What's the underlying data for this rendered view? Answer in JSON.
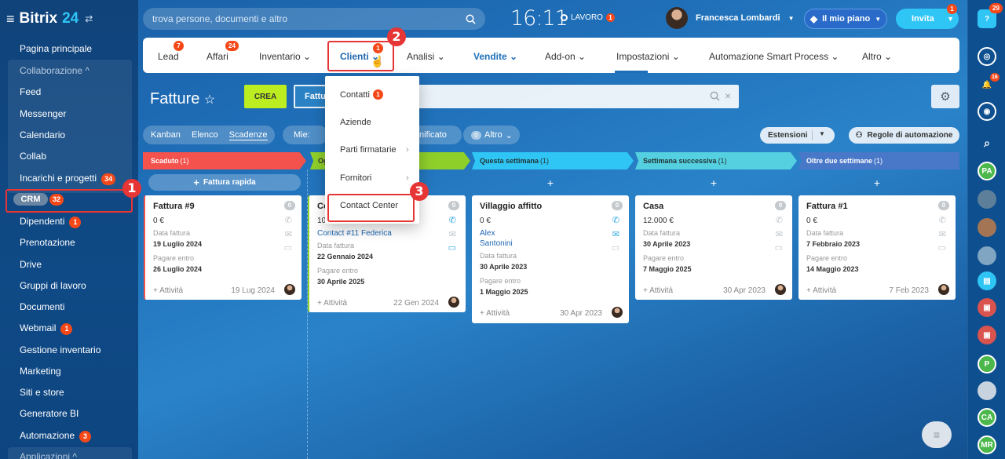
{
  "app": {
    "logo_text": "Bitrix",
    "logo_num": "24",
    "search_placeholder": "trova persone, documenti e altro",
    "clock": "16:11",
    "work_label": "LAVORO",
    "work_badge": "1",
    "user_name": "Francesca Lombardi",
    "plan_label": "Il mio piano",
    "invite_label": "Invita",
    "invite_badge": "1"
  },
  "sidebar": {
    "items": [
      {
        "label": "Pagina principale"
      },
      {
        "label": "Collaborazione ^"
      },
      {
        "label": "Feed"
      },
      {
        "label": "Messenger"
      },
      {
        "label": "Calendario"
      },
      {
        "label": "Collab"
      },
      {
        "label": "Incarichi e progetti",
        "badge": "34"
      },
      {
        "label": "CRM",
        "badge": "32"
      },
      {
        "label": "Dipendenti",
        "badge": "1"
      },
      {
        "label": "Prenotazione"
      },
      {
        "label": "Drive"
      },
      {
        "label": "Gruppi di lavoro"
      },
      {
        "label": "Documenti"
      },
      {
        "label": "Webmail",
        "badge": "1"
      },
      {
        "label": "Gestione inventario"
      },
      {
        "label": "Marketing"
      },
      {
        "label": "Siti e store"
      },
      {
        "label": "Generatore BI"
      },
      {
        "label": "Automazione",
        "badge": "3"
      },
      {
        "label": "Applicazioni ^"
      }
    ]
  },
  "crm_nav": {
    "tabs": [
      {
        "label": "Lead",
        "badge": "7"
      },
      {
        "label": "Affari",
        "badge": "24"
      },
      {
        "label": "Inventario"
      },
      {
        "label": "Clienti",
        "badge": "1"
      },
      {
        "label": "Analisi"
      },
      {
        "label": "Vendite"
      },
      {
        "label": "Add-on"
      },
      {
        "label": "Impostazioni"
      },
      {
        "label": "Automazione Smart Process"
      },
      {
        "label": "Altro"
      }
    ]
  },
  "page": {
    "title": "Fatture",
    "create_label": "CREA",
    "filter_chip": "Fattu",
    "views": [
      "Kanban",
      "Elenco",
      "Scadenze"
    ],
    "my_label": "Mie:",
    "pianificato": "nificato",
    "altro": "Altro",
    "altro_count": "0",
    "estensioni": "Estensioni",
    "regole": "Regole di automazione"
  },
  "dropdown": {
    "items": [
      {
        "label": "Contatti",
        "badge": "1"
      },
      {
        "label": "Aziende"
      },
      {
        "label": "Parti firmatarie"
      },
      {
        "label": "Fornitori"
      },
      {
        "label": "Contact Center"
      }
    ]
  },
  "steps": [
    "1",
    "2",
    "3"
  ],
  "columns": [
    {
      "title": "Scaduto",
      "count": "(1)",
      "color": "#f4524d",
      "add_label": "Fattura rapida"
    },
    {
      "title": "Og",
      "count": "",
      "color": "#8fcf2a",
      "add_label": "+"
    },
    {
      "title": "Questa settimana",
      "count": "(1)",
      "color": "#2fc6f6",
      "add_label": "+"
    },
    {
      "title": "Settimana successiva",
      "count": "(1)",
      "color": "#55d0e0",
      "add_label": "+"
    },
    {
      "title": "Oltre due settimane",
      "count": "(1)",
      "color": "#4a78c8",
      "add_label": "+"
    }
  ],
  "cards": [
    {
      "title": "Fattura #9",
      "amount": "0 €",
      "l1": "Data fattura",
      "v1": "19 Luglio 2024",
      "l2": "Pagare entro",
      "v2": "26 Luglio 2024",
      "activity": "+ Attività",
      "date": "19 Lug 2024",
      "count": "0"
    },
    {
      "title": "Co",
      "amount": "100",
      "link": "Contact #11 Federica",
      "l1": "Data fattura",
      "v1": "22 Gennaio 2024",
      "l2": "Pagare entro",
      "v2": "30 Aprile 2025",
      "activity": "+ Attività",
      "date": "22 Gen 2024",
      "count": "0"
    },
    {
      "title": "Villaggio affitto",
      "amount": "0 €",
      "link1": "Alex",
      "link2": "Santonini",
      "l1": "Data fattura",
      "v1": "30 Aprile 2023",
      "l2": "Pagare entro",
      "v2": "1 Maggio 2025",
      "activity": "+ Attività",
      "date": "30 Apr 2023",
      "count": "0"
    },
    {
      "title": "Casa",
      "amount": "12.000 €",
      "l1": "Data fattura",
      "v1": "30 Aprile 2023",
      "l2": "Pagare entro",
      "v2": "7 Maggio 2025",
      "activity": "+ Attività",
      "date": "30 Apr 2023",
      "count": "0"
    },
    {
      "title": "Fattura #1",
      "amount": "0 €",
      "l1": "Data fattura",
      "v1": "7 Febbraio 2023",
      "l2": "Pagare entro",
      "v2": "14 Maggio 2023",
      "activity": "+ Attività",
      "date": "7 Feb 2023",
      "count": "0"
    }
  ],
  "rightbar": {
    "notif_badge": "29",
    "bell_badge": "16",
    "items": [
      "PA",
      "P",
      "CA",
      "MR"
    ]
  },
  "colors": {
    "accent": "#2fc6f6",
    "create": "#bbed21",
    "alert": "#e63535",
    "badge": "#f54819"
  }
}
